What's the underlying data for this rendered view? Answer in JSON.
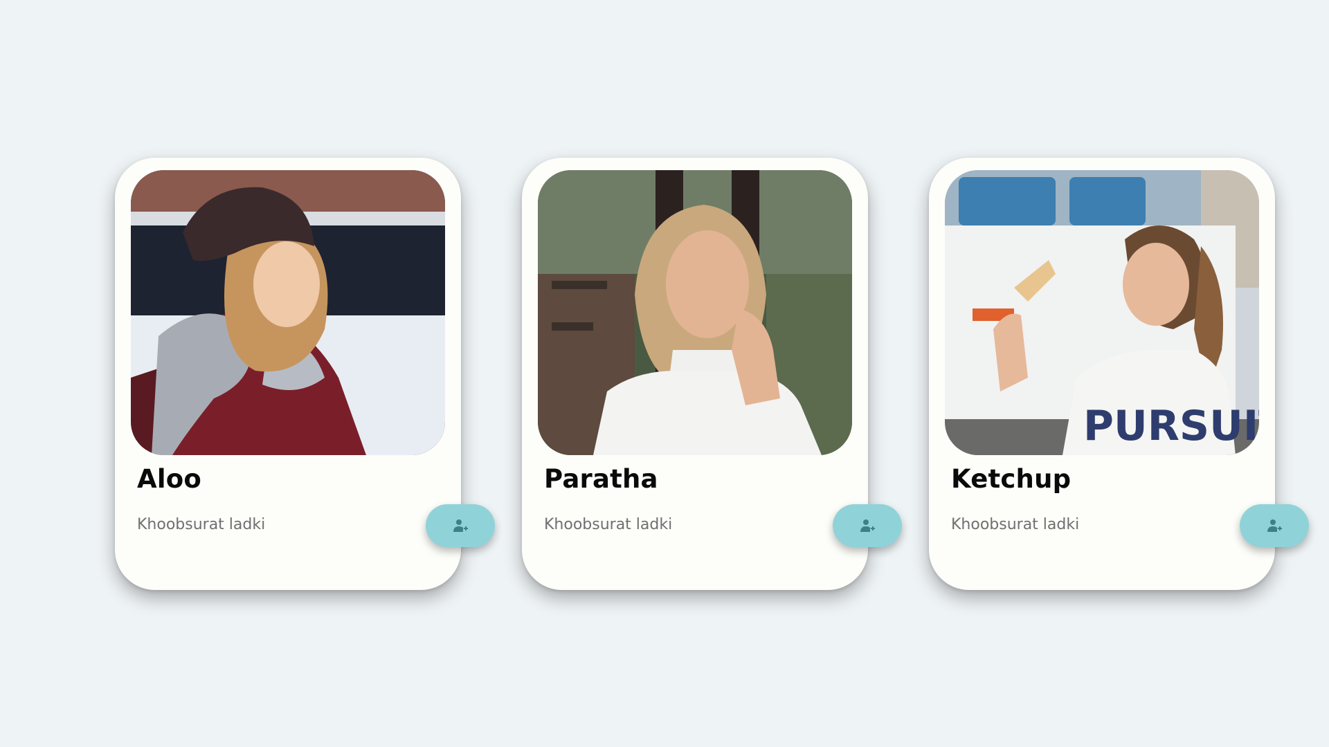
{
  "cards": [
    {
      "name": "Aloo",
      "subtitle": "Khoobsurat ladki",
      "photo_subject": "woman in knit beanie and grey scarf in snow",
      "action_icon": "add-user-icon"
    },
    {
      "name": "Paratha",
      "subtitle": "Khoobsurat ladki",
      "photo_subject": "woman in white turtleneck resting cheek on hand at cafe",
      "action_icon": "add-user-icon"
    },
    {
      "name": "Ketchup",
      "subtitle": "Khoobsurat ladki",
      "photo_subject": "woman eating ice cream cone in front of white truck",
      "action_icon": "add-user-icon"
    }
  ],
  "colors": {
    "background": "#eef3f5",
    "card": "#fdfdfa",
    "button": "#8fd3d9",
    "button_icon": "#3f7f86",
    "name_text": "#0a0a0a",
    "subtitle_text": "#6f6f6f"
  }
}
